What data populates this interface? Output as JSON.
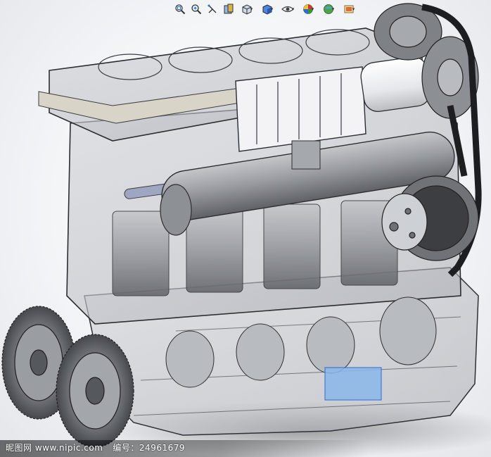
{
  "toolbar": {
    "tools": [
      {
        "name": "zoom-to-fit",
        "icon": "zoom-fit-icon"
      },
      {
        "name": "zoom-to-area",
        "icon": "zoom-area-icon"
      },
      {
        "name": "previous-view",
        "icon": "previous-view-icon"
      },
      {
        "name": "section-view",
        "icon": "section-view-icon"
      },
      {
        "name": "view-orientation",
        "icon": "view-orientation-icon"
      },
      {
        "name": "display-style",
        "icon": "display-style-icon"
      },
      {
        "name": "hide-show-items",
        "icon": "hide-show-icon"
      },
      {
        "name": "edit-appearance",
        "icon": "appearance-icon"
      },
      {
        "name": "apply-scene",
        "icon": "scene-icon"
      },
      {
        "name": "view-settings",
        "icon": "view-settings-icon"
      }
    ],
    "dropdown_glyph": "▾"
  },
  "watermark": {
    "site": "昵图网 www.nipic.com",
    "id_label": "编号：",
    "id_value": "24961679"
  },
  "colors": {
    "accent": "#2b6cd6",
    "engine_gray": "#8c8f94",
    "highlight_blue": "#7fb2e8"
  }
}
